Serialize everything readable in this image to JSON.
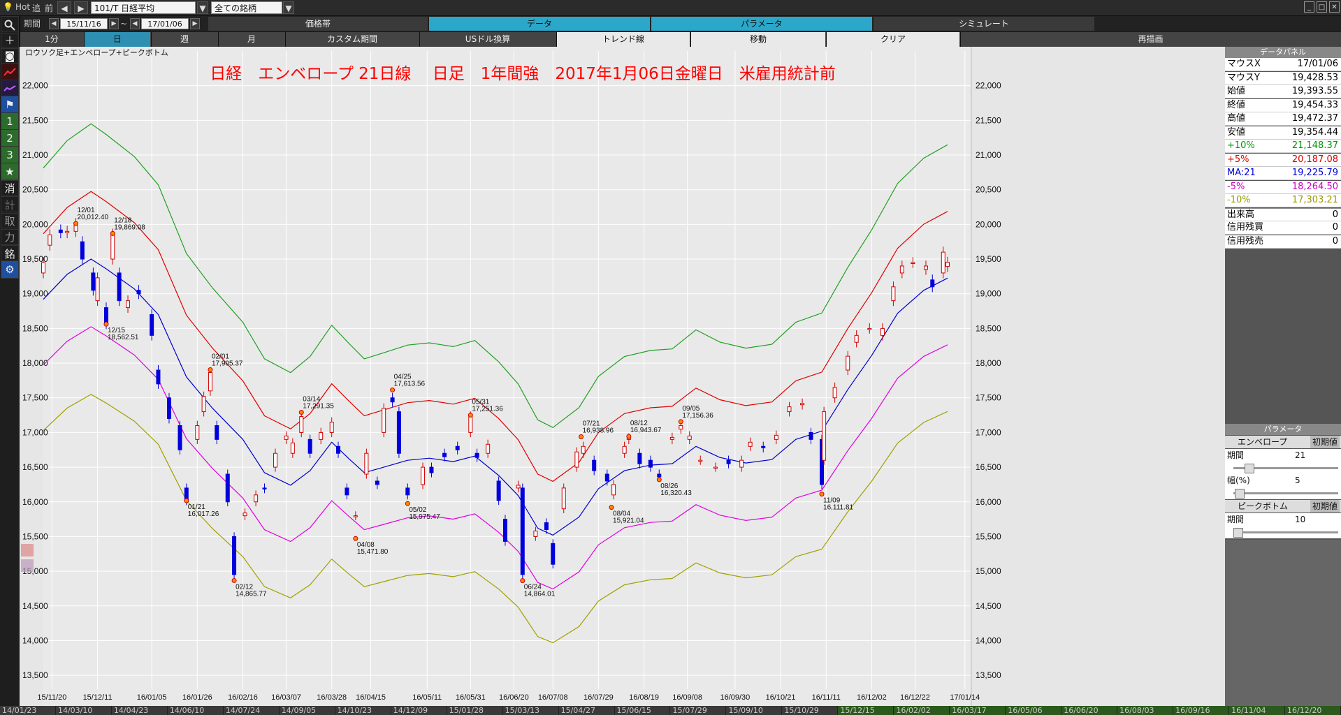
{
  "toolbar": {
    "hot_label": "Hot",
    "back_label": "追",
    "forward_label": "前",
    "symbol": "101/T 日経平均",
    "scope": "全ての銘柄"
  },
  "period": {
    "label": "期間",
    "from": "15/11/16",
    "sep": "~",
    "to": "17/01/06"
  },
  "sections": [
    "価格帯",
    "データ",
    "パラメータ",
    "シミュレート"
  ],
  "timeframes": [
    "1分",
    "日",
    "週",
    "月",
    "カスタム期間",
    "USドル換算",
    "トレンド線",
    "移動",
    "クリア",
    "再描画"
  ],
  "left_tools": {
    "btn1": "1",
    "btn2": "2",
    "btn3": "3",
    "k_erase": "消",
    "k_calc": "計",
    "k_get": "取",
    "k_power": "力",
    "k_brand": "銘"
  },
  "chart_data": {
    "type": "line",
    "subtitle": "ロウソク足+エンベロープ+ピークボトム",
    "title": "日経　エンベロープ 21日線　 日足　1年間強　2017年1月06日金曜日　米雇用統計前",
    "ylim": [
      13300,
      22500
    ],
    "yticks": [
      "22,000",
      "21,500",
      "21,000",
      "20,500",
      "20,000",
      "19,500",
      "19,000",
      "18,500",
      "18,000",
      "17,500",
      "17,000",
      "16,500",
      "16,000",
      "15,500",
      "15,000",
      "14,500",
      "14,000",
      "13,500"
    ],
    "xticks": [
      "15/11/20",
      "15/12/11",
      "16/01/05",
      "16/01/26",
      "16/02/16",
      "16/03/07",
      "16/03/28",
      "16/04/15",
      "16/05/11",
      "16/05/31",
      "16/06/20",
      "16/07/08",
      "16/07/29",
      "16/08/19",
      "16/09/08",
      "16/09/30",
      "16/10/21",
      "16/11/11",
      "16/12/02",
      "16/12/22",
      "17/01/14"
    ],
    "ma21": [
      {
        "x": "15/11/16",
        "y": 18920
      },
      {
        "x": "15/11/27",
        "y": 19280
      },
      {
        "x": "15/12/08",
        "y": 19500
      },
      {
        "x": "15/12/15",
        "y": 19360
      },
      {
        "x": "15/12/28",
        "y": 19070
      },
      {
        "x": "16/01/08",
        "y": 18700
      },
      {
        "x": "16/01/21",
        "y": 17800
      },
      {
        "x": "16/02/02",
        "y": 17350
      },
      {
        "x": "16/02/16",
        "y": 16900
      },
      {
        "x": "16/02/26",
        "y": 16420
      },
      {
        "x": "16/03/09",
        "y": 16240
      },
      {
        "x": "16/03/18",
        "y": 16450
      },
      {
        "x": "16/03/28",
        "y": 16860
      },
      {
        "x": "16/04/05",
        "y": 16620
      },
      {
        "x": "16/04/12",
        "y": 16420
      },
      {
        "x": "16/04/21",
        "y": 16500
      },
      {
        "x": "16/05/02",
        "y": 16600
      },
      {
        "x": "16/05/12",
        "y": 16630
      },
      {
        "x": "16/05/23",
        "y": 16580
      },
      {
        "x": "16/06/02",
        "y": 16660
      },
      {
        "x": "16/06/13",
        "y": 16380
      },
      {
        "x": "16/06/22",
        "y": 16090
      },
      {
        "x": "16/07/01",
        "y": 15620
      },
      {
        "x": "16/07/08",
        "y": 15520
      },
      {
        "x": "16/07/20",
        "y": 15780
      },
      {
        "x": "16/07/29",
        "y": 16190
      },
      {
        "x": "16/08/10",
        "y": 16450
      },
      {
        "x": "16/08/22",
        "y": 16530
      },
      {
        "x": "16/09/01",
        "y": 16550
      },
      {
        "x": "16/09/12",
        "y": 16800
      },
      {
        "x": "16/09/23",
        "y": 16640
      },
      {
        "x": "16/10/05",
        "y": 16560
      },
      {
        "x": "16/10/17",
        "y": 16610
      },
      {
        "x": "16/10/28",
        "y": 16900
      },
      {
        "x": "16/11/09",
        "y": 17020
      },
      {
        "x": "16/11/21",
        "y": 17620
      },
      {
        "x": "16/12/02",
        "y": 18110
      },
      {
        "x": "16/12/14",
        "y": 18720
      },
      {
        "x": "16/12/26",
        "y": 19050
      },
      {
        "x": "17/01/06",
        "y": 19225.79
      }
    ],
    "envelope_pct": [
      10,
      5,
      -5,
      -10
    ],
    "candles": [
      {
        "x": "15/11/16",
        "o": 19300,
        "c": 19450
      },
      {
        "x": "15/11/19",
        "o": 19700,
        "c": 19850
      },
      {
        "x": "15/11/24",
        "o": 19920,
        "c": 19880
      },
      {
        "x": "15/11/27",
        "o": 19880,
        "c": 19900
      },
      {
        "x": "15/12/01",
        "o": 19900,
        "c": 20012
      },
      {
        "x": "15/12/04",
        "o": 19750,
        "c": 19500
      },
      {
        "x": "15/12/09",
        "o": 19300,
        "c": 19050
      },
      {
        "x": "15/12/11",
        "o": 18900,
        "c": 19230
      },
      {
        "x": "15/12/15",
        "o": 18800,
        "c": 18565
      },
      {
        "x": "15/12/18",
        "o": 19500,
        "c": 19860
      },
      {
        "x": "15/12/21",
        "o": 19300,
        "c": 18900
      },
      {
        "x": "15/12/25",
        "o": 18800,
        "c": 18900
      },
      {
        "x": "15/12/30",
        "o": 19050,
        "c": 19000
      },
      {
        "x": "16/01/05",
        "o": 18700,
        "c": 18400
      },
      {
        "x": "16/01/08",
        "o": 17900,
        "c": 17700
      },
      {
        "x": "16/01/13",
        "o": 17500,
        "c": 17200
      },
      {
        "x": "16/01/18",
        "o": 17100,
        "c": 16750
      },
      {
        "x": "16/01/21",
        "o": 16200,
        "c": 16017
      },
      {
        "x": "16/01/26",
        "o": 16900,
        "c": 17100
      },
      {
        "x": "16/01/29",
        "o": 17300,
        "c": 17520
      },
      {
        "x": "16/02/01",
        "o": 17600,
        "c": 17865
      },
      {
        "x": "16/02/04",
        "o": 17100,
        "c": 16900
      },
      {
        "x": "16/02/09",
        "o": 16400,
        "c": 16000
      },
      {
        "x": "16/02/12",
        "o": 15500,
        "c": 14952
      },
      {
        "x": "16/02/17",
        "o": 15800,
        "c": 15840
      },
      {
        "x": "16/02/22",
        "o": 16000,
        "c": 16100
      },
      {
        "x": "16/02/26",
        "o": 16200,
        "c": 16190
      },
      {
        "x": "16/03/02",
        "o": 16500,
        "c": 16700
      },
      {
        "x": "16/03/07",
        "o": 16900,
        "c": 16950
      },
      {
        "x": "16/03/10",
        "o": 16700,
        "c": 16850
      },
      {
        "x": "16/03/14",
        "o": 17000,
        "c": 17230
      },
      {
        "x": "16/03/18",
        "o": 16900,
        "c": 16700
      },
      {
        "x": "16/03/23",
        "o": 16900,
        "c": 17000
      },
      {
        "x": "16/03/28",
        "o": 17000,
        "c": 17150
      },
      {
        "x": "16/03/31",
        "o": 16800,
        "c": 16700
      },
      {
        "x": "16/04/04",
        "o": 16200,
        "c": 16100
      },
      {
        "x": "16/04/08",
        "o": 15800,
        "c": 15800
      },
      {
        "x": "16/04/13",
        "o": 16400,
        "c": 16700
      },
      {
        "x": "16/04/18",
        "o": 16300,
        "c": 16250
      },
      {
        "x": "16/04/21",
        "o": 17000,
        "c": 17350
      },
      {
        "x": "16/04/25",
        "o": 17500,
        "c": 17440
      },
      {
        "x": "16/04/28",
        "o": 17300,
        "c": 16700
      },
      {
        "x": "16/05/02",
        "o": 16200,
        "c": 16100
      },
      {
        "x": "16/05/09",
        "o": 16250,
        "c": 16500
      },
      {
        "x": "16/05/13",
        "o": 16500,
        "c": 16420
      },
      {
        "x": "16/05/19",
        "o": 16700,
        "c": 16650
      },
      {
        "x": "16/05/25",
        "o": 16800,
        "c": 16750
      },
      {
        "x": "16/05/31",
        "o": 17000,
        "c": 17235
      },
      {
        "x": "16/06/03",
        "o": 16700,
        "c": 16640
      },
      {
        "x": "16/06/08",
        "o": 16700,
        "c": 16830
      },
      {
        "x": "16/06/13",
        "o": 16300,
        "c": 16020
      },
      {
        "x": "16/06/16",
        "o": 15750,
        "c": 15430
      },
      {
        "x": "16/06/22",
        "o": 16200,
        "c": 16240
      },
      {
        "x": "16/06/24",
        "o": 16200,
        "c": 14952
      },
      {
        "x": "16/06/30",
        "o": 15500,
        "c": 15580
      },
      {
        "x": "16/07/05",
        "o": 15700,
        "c": 15600
      },
      {
        "x": "16/07/08",
        "o": 15400,
        "c": 15100
      },
      {
        "x": "16/07/13",
        "o": 15900,
        "c": 16200
      },
      {
        "x": "16/07/19",
        "o": 16500,
        "c": 16720
      },
      {
        "x": "16/07/22",
        "o": 16700,
        "c": 16800
      },
      {
        "x": "16/07/27",
        "o": 16600,
        "c": 16450
      },
      {
        "x": "16/08/02",
        "o": 16400,
        "c": 16300
      },
      {
        "x": "16/08/05",
        "o": 16100,
        "c": 16250
      },
      {
        "x": "16/08/10",
        "o": 16700,
        "c": 16800
      },
      {
        "x": "16/08/12",
        "o": 16900,
        "c": 16920
      },
      {
        "x": "16/08/17",
        "o": 16700,
        "c": 16550
      },
      {
        "x": "16/08/22",
        "o": 16600,
        "c": 16500
      },
      {
        "x": "16/08/26",
        "o": 16400,
        "c": 16360
      },
      {
        "x": "16/09/01",
        "o": 16900,
        "c": 16930
      },
      {
        "x": "16/09/05",
        "o": 17050,
        "c": 17100
      },
      {
        "x": "16/09/09",
        "o": 16900,
        "c": 16950
      },
      {
        "x": "16/09/14",
        "o": 16600,
        "c": 16600
      },
      {
        "x": "16/09/21",
        "o": 16500,
        "c": 16500
      },
      {
        "x": "16/09/27",
        "o": 16600,
        "c": 16550
      },
      {
        "x": "16/10/03",
        "o": 16500,
        "c": 16600
      },
      {
        "x": "16/10/07",
        "o": 16800,
        "c": 16860
      },
      {
        "x": "16/10/13",
        "o": 16800,
        "c": 16780
      },
      {
        "x": "16/10/19",
        "o": 16900,
        "c": 16960
      },
      {
        "x": "16/10/25",
        "o": 17300,
        "c": 17370
      },
      {
        "x": "16/10/31",
        "o": 17400,
        "c": 17420
      },
      {
        "x": "16/11/04",
        "o": 17000,
        "c": 16900
      },
      {
        "x": "16/11/09",
        "o": 16900,
        "c": 16250
      },
      {
        "x": "16/11/10",
        "o": 16600,
        "c": 17300
      },
      {
        "x": "16/11/15",
        "o": 17500,
        "c": 17650
      },
      {
        "x": "16/11/21",
        "o": 17900,
        "c": 18100
      },
      {
        "x": "16/11/25",
        "o": 18300,
        "c": 18400
      },
      {
        "x": "16/12/01",
        "o": 18500,
        "c": 18500
      },
      {
        "x": "16/12/07",
        "o": 18400,
        "c": 18500
      },
      {
        "x": "16/12/12",
        "o": 18900,
        "c": 19100
      },
      {
        "x": "16/12/16",
        "o": 19300,
        "c": 19400
      },
      {
        "x": "16/12/21",
        "o": 19450,
        "c": 19450
      },
      {
        "x": "16/12/27",
        "o": 19350,
        "c": 19400
      },
      {
        "x": "16/12/30",
        "o": 19200,
        "c": 19100
      },
      {
        "x": "17/01/04",
        "o": 19300,
        "c": 19600
      },
      {
        "x": "17/01/06",
        "o": 19393.55,
        "c": 19454.33
      }
    ],
    "annotations": [
      {
        "date": "12/01",
        "value": "20,012.40",
        "x": "15/12/01",
        "y": 20012.4,
        "pos": "above"
      },
      {
        "date": "12/18",
        "value": "19,869.08",
        "x": "15/12/18",
        "y": 19869.08,
        "pos": "above"
      },
      {
        "date": "12/15",
        "value": "18,562.51",
        "x": "15/12/15",
        "y": 18562.51,
        "pos": "below"
      },
      {
        "date": "02/01",
        "value": "17,905.37",
        "x": "16/02/01",
        "y": 17905.37,
        "pos": "above"
      },
      {
        "date": "01/21",
        "value": "16,017.26",
        "x": "16/01/21",
        "y": 16017.26,
        "pos": "below"
      },
      {
        "date": "02/12",
        "value": "14,865.77",
        "x": "16/02/12",
        "y": 14865.77,
        "pos": "below"
      },
      {
        "date": "03/14",
        "value": "17,291.35",
        "x": "16/03/14",
        "y": 17291.35,
        "pos": "above"
      },
      {
        "date": "04/25",
        "value": "17,613.56",
        "x": "16/04/25",
        "y": 17613.56,
        "pos": "above"
      },
      {
        "date": "04/08",
        "value": "15,471.80",
        "x": "16/04/08",
        "y": 15471.8,
        "pos": "below"
      },
      {
        "date": "05/02",
        "value": "15,975.47",
        "x": "16/05/02",
        "y": 15975.47,
        "pos": "below"
      },
      {
        "date": "05/31",
        "value": "17,251.36",
        "x": "16/05/31",
        "y": 17251.36,
        "pos": "above"
      },
      {
        "date": "06/24",
        "value": "14,864.01",
        "x": "16/06/24",
        "y": 14864.01,
        "pos": "below"
      },
      {
        "date": "07/21",
        "value": "16,938.96",
        "x": "16/07/21",
        "y": 16938.96,
        "pos": "above"
      },
      {
        "date": "08/12",
        "value": "16,943.67",
        "x": "16/08/12",
        "y": 16943.67,
        "pos": "above"
      },
      {
        "date": "08/04",
        "value": "15,921.04",
        "x": "16/08/04",
        "y": 15921.04,
        "pos": "below"
      },
      {
        "date": "08/26",
        "value": "16,320.43",
        "x": "16/08/26",
        "y": 16320.43,
        "pos": "below"
      },
      {
        "date": "09/05",
        "value": "17,156.36",
        "x": "16/09/05",
        "y": 17156.36,
        "pos": "above"
      },
      {
        "date": "11/09",
        "value": "16,111.81",
        "x": "16/11/09",
        "y": 16111.81,
        "pos": "below"
      }
    ],
    "colors": {
      "plus10": "#1fa01f",
      "plus5": "#e00000",
      "ma": "#0000cc",
      "minus5": "#e000e0",
      "minus10": "#a0a000",
      "up": "#d00000",
      "down": "#0000dd",
      "title": "#ff0000"
    }
  },
  "data_panel": {
    "title": "データパネル",
    "rows": [
      {
        "k": "マウスX",
        "v": "17/01/06"
      },
      {
        "k": "マウスY",
        "v": "19,428.53"
      },
      {
        "k": "始値",
        "v": "19,393.55"
      },
      {
        "k": "終値",
        "v": "19,454.33"
      },
      {
        "k": "高値",
        "v": "19,472.37"
      },
      {
        "k": "安値",
        "v": "19,354.44"
      },
      {
        "k": "+10%",
        "v": "21,148.37",
        "color": "#009900"
      },
      {
        "k": "+5%",
        "v": "20,187.08",
        "color": "#dd0000"
      },
      {
        "k": "MA:21",
        "v": "19,225.79",
        "color": "#0000dd"
      },
      {
        "k": "-5%",
        "v": "18,264.50",
        "color": "#cc00cc"
      },
      {
        "k": "-10%",
        "v": "17,303.21",
        "color": "#999900"
      },
      {
        "k": "出来高",
        "v": "0"
      },
      {
        "k": "信用残買",
        "v": "0"
      },
      {
        "k": "信用残売",
        "v": "0"
      }
    ]
  },
  "param_panel": {
    "title": "パラメータ",
    "envelope_label": "エンベロープ",
    "reset_label": "初期値",
    "period_label": "期間",
    "period_value": "21",
    "width_label": "幅(%)",
    "width_value": "5",
    "peak_label": "ピークボトム",
    "peak_reset_label": "初期値",
    "peak_period_label": "期間",
    "peak_period_value": "10"
  },
  "bottom_timeline": [
    "14/01/23",
    "14/03/10",
    "14/04/23",
    "14/06/10",
    "14/07/24",
    "14/09/05",
    "14/10/23",
    "14/12/09",
    "15/01/28",
    "15/03/13",
    "15/04/27",
    "15/06/15",
    "15/07/29",
    "15/09/10",
    "15/10/29",
    "15/12/15",
    "16/02/02",
    "16/03/17",
    "16/05/06",
    "16/06/20",
    "16/08/03",
    "16/09/16",
    "16/11/04",
    "16/12/20"
  ]
}
